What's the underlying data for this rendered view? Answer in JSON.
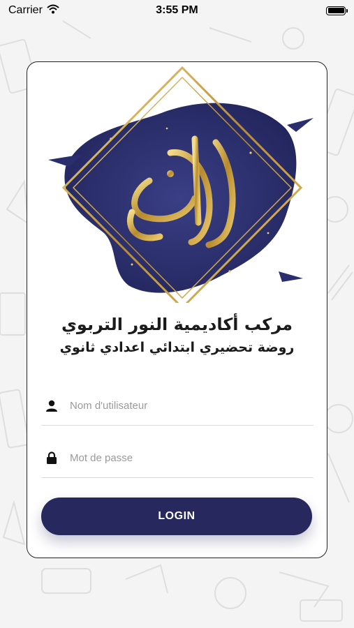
{
  "status_bar": {
    "carrier": "Carrier",
    "time": "3:55 PM"
  },
  "logo": {
    "name": "Al Nour academy calligraphy logo"
  },
  "academy": {
    "title": "مركب أكاديمية النور التربوي",
    "subtitle": "روضة تحضيري ابتدائي اعدادي ثانوي"
  },
  "form": {
    "username_placeholder": "Nom d'utilisateur",
    "password_placeholder": "Mot de passe",
    "login_label": "LOGIN"
  },
  "colors": {
    "accent": "#27295e",
    "gold": "#c9a24a"
  }
}
